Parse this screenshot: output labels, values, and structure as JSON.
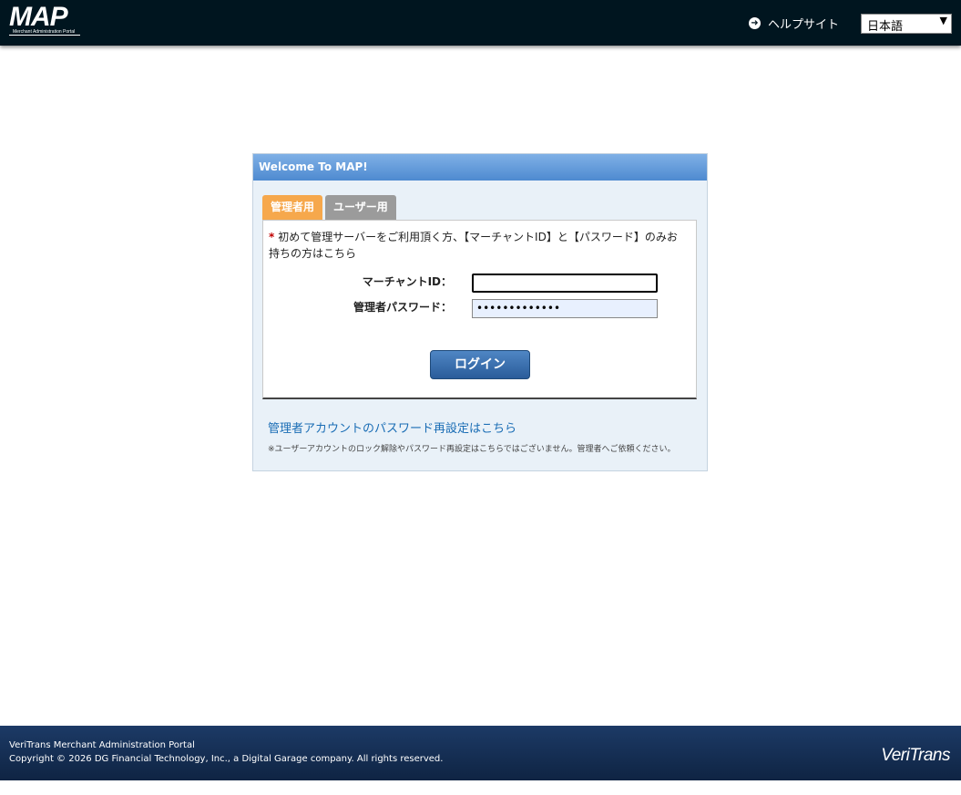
{
  "header": {
    "logo_text": "MAP",
    "logo_subtitle": "Merchant Administration Portal",
    "help_link": "ヘルプサイト",
    "help_icon": "arrow-right-circle-icon",
    "language": {
      "selected": "日本語"
    }
  },
  "login": {
    "panel_title": "Welcome To MAP!",
    "tabs": [
      {
        "label": "管理者用",
        "active": true
      },
      {
        "label": "ユーザー用",
        "active": false
      }
    ],
    "notice_mark": "*",
    "notice": "初めて管理サーバーをご利用頂く方、【マーチャントID】と【パスワード】のみお持ちの方はこちら",
    "merchant_id_label": "マーチャントID：",
    "merchant_id_value": "",
    "password_label": "管理者パスワード：",
    "password_value": "•••••••••••••",
    "login_button": "ログイン",
    "reset_link": "管理者アカウントのパスワード再設定はこちら",
    "reset_note": "※ユーザーアカウントのロック解除やパスワード再設定はこちらではございません。管理者へご依頼ください。"
  },
  "footer": {
    "line1": "VeriTrans Merchant Administration Portal",
    "line2": "Copyright © 2026 DG Financial Technology, Inc., a Digital Garage company. All rights reserved.",
    "logo": "VeriTrans"
  },
  "colors": {
    "header_bg": "#00151f",
    "tab_active": "#f6a84c",
    "tab_inactive": "#9b9b9b",
    "panel_head": "#5b94d6",
    "link": "#1a6db5",
    "footer_bg": "#16305a"
  }
}
